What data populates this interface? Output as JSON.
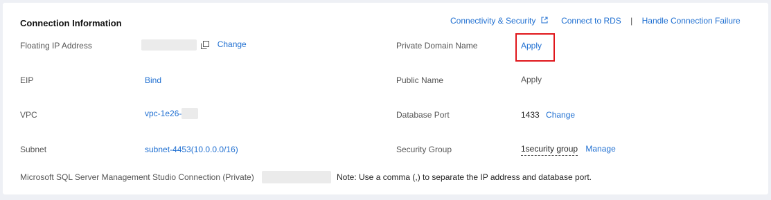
{
  "section": {
    "title": "Connection Information"
  },
  "header_links": {
    "connectivity": "Connectivity & Security",
    "connect_rds": "Connect to RDS",
    "separator": "|",
    "handle_failure": "Handle Connection Failure"
  },
  "left": {
    "floating_ip": {
      "label": "Floating IP Address",
      "action": "Change"
    },
    "eip": {
      "label": "EIP",
      "action": "Bind"
    },
    "vpc": {
      "label": "VPC",
      "value": "vpc-1e26-"
    },
    "subnet": {
      "label": "Subnet",
      "value": "subnet-4453(10.0.0.0/16)"
    }
  },
  "right": {
    "private_domain": {
      "label": "Private Domain Name",
      "action": "Apply"
    },
    "public_name": {
      "label": "Public Name",
      "value": "Apply"
    },
    "db_port": {
      "label": "Database Port",
      "value": "1433",
      "action": "Change"
    },
    "security_group": {
      "label": "Security Group",
      "value": "1security group",
      "action": "Manage"
    }
  },
  "ssms": {
    "label": "Microsoft SQL Server Management Studio Connection (Private)",
    "note": "Note: Use a comma (,) to separate the IP address and database port."
  },
  "colors": {
    "link": "#1f6fd1",
    "highlight": "#e0161b"
  }
}
